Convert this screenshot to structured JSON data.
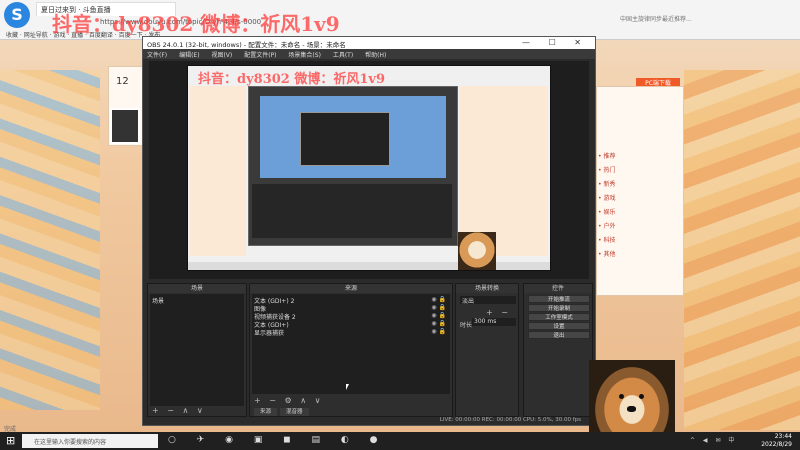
{
  "browser": {
    "tab_title": "夏日过来到 · 斗鱼直播",
    "url": "https://www.douyu.com/topic/D-yh-4.4/s-0000",
    "search_hint": "中国主旋律同步最近推荐...",
    "bookmarks": "收藏 · 网址导航 · 游戏 · 直播 · 百度翻译 · 百度一下 · 发布"
  },
  "watermark": "抖音：dy8302 微博：祈风1v9",
  "preview_watermark": "抖音：dy8302 微博：祈风1v9",
  "page": {
    "count": "12",
    "badge": "PC端下载",
    "list_items": [
      "• 推荐",
      "• 热门",
      "• 新秀",
      "• 游戏",
      "• 娱乐",
      "• 户外",
      "• 科技",
      "• 其他"
    ]
  },
  "obs": {
    "title": "OBS 24.0.1 (32-bit, windows) - 配置文件：未命名 - 场景：未命名",
    "window_buttons": "— ☐ ✕",
    "menu": [
      "文件(F)",
      "编辑(E)",
      "视图(V)",
      "配置文件(P)",
      "场景集合(S)",
      "工具(T)",
      "帮助(H)"
    ],
    "scenes_title": "场景",
    "scenes": [
      "场景"
    ],
    "sources_title": "来源",
    "sources": [
      "文本 (GDI+) 2",
      "图像",
      "视频捕获设备 2",
      "文本 (GDI+)",
      "显示器捕获"
    ],
    "mixer_title": "场景转换",
    "transition_value": "淡出",
    "duration_label": "时长",
    "duration_value": "300 ms",
    "controls_title": "控件",
    "controls": [
      "开始推流",
      "开始录制",
      "工作室模式",
      "设置",
      "退出"
    ],
    "tabs": [
      "来源",
      "混音器"
    ],
    "status": "LIVE: 00:00:00    REC: 00:00:00    CPU: 5.0%, 30.00 fps"
  },
  "taskbar": {
    "search_placeholder": "在这里输入你要搜索的内容",
    "time": "23:44",
    "date": "2022/8/29",
    "tray": "^ ◀ ✉ 中"
  },
  "status_bar": "完成"
}
